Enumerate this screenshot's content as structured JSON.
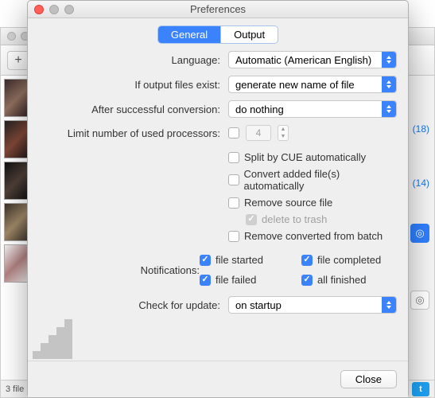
{
  "bg": {
    "sidebar_links": {
      "a": "(18)",
      "b": "(14)"
    },
    "status": "3 file"
  },
  "modal": {
    "title": "Preferences",
    "tabs": {
      "general": "General",
      "output": "Output"
    },
    "labels": {
      "language": "Language:",
      "if_exist": "If output files exist:",
      "after_conv": "After successful conversion:",
      "limit_proc": "Limit number of used processors:",
      "notifications": "Notifications:",
      "check_update": "Check for update:"
    },
    "values": {
      "language": "Automatic (American English)",
      "if_exist": "generate new name of file",
      "after_conv": "do nothing",
      "proc_num": "4",
      "check_update": "on startup"
    },
    "checks": {
      "split_cue": "Split by CUE automatically",
      "convert_auto": "Convert added file(s) automatically",
      "remove_source": "Remove source file",
      "delete_trash": "delete to trash",
      "remove_converted": "Remove converted from batch",
      "file_started": "file started",
      "file_completed": "file completed",
      "file_failed": "file failed",
      "all_finished": "all finished"
    },
    "close": "Close"
  }
}
